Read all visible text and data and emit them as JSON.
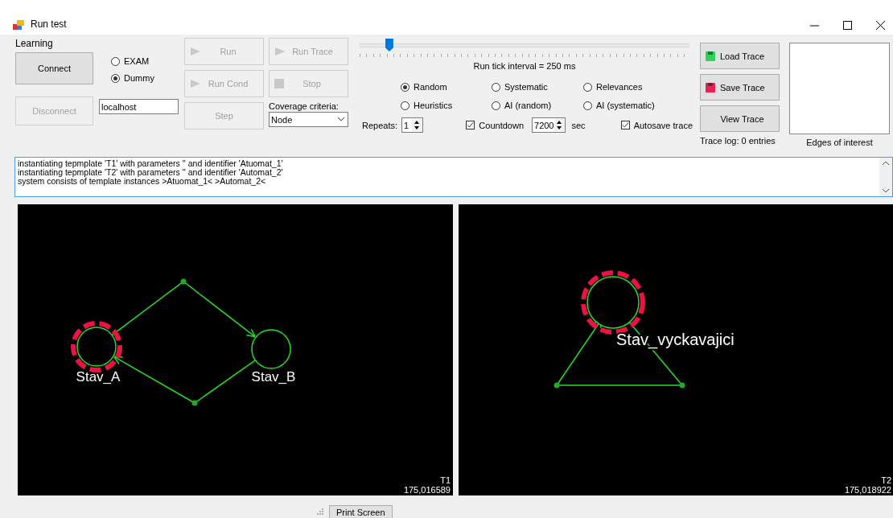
{
  "window": {
    "title": "Run test"
  },
  "learning": {
    "label": "Learning",
    "connect": {
      "label": "Connect",
      "disabled": false
    },
    "disconnect": {
      "label": "Disconnect",
      "disabled": true
    },
    "modes": [
      {
        "label": "EXAM",
        "selected": false
      },
      {
        "label": "Dummy",
        "selected": true
      }
    ],
    "host": "localhost"
  },
  "run_buttons": [
    {
      "label": "Run",
      "kind": "play",
      "disabled": true
    },
    {
      "label": "Run Cond",
      "kind": "play",
      "disabled": true
    },
    {
      "label": "Step",
      "kind": "plain",
      "disabled": true
    }
  ],
  "trace_buttons": [
    {
      "label": "Run Trace",
      "kind": "play",
      "disabled": true
    },
    {
      "label": "Stop",
      "kind": "stop",
      "disabled": true
    }
  ],
  "coverage": {
    "label": "Coverage criteria:",
    "value": "Node"
  },
  "tick_slider": {
    "level": 0.09,
    "reading": "Run tick interval = 250 ms"
  },
  "strategies": [
    {
      "label": "Random",
      "selected": true
    },
    {
      "label": "Systematic",
      "selected": false
    },
    {
      "label": "Relevances",
      "selected": false
    },
    {
      "label": "Heuristics",
      "selected": false
    },
    {
      "label": "AI (random)",
      "selected": false
    },
    {
      "label": "AI (systematic)",
      "selected": false
    }
  ],
  "repeats": {
    "label": "Repeats:",
    "value": "1"
  },
  "countdown": {
    "label": "Countdown",
    "checked": true,
    "value": "7200",
    "unit": "sec"
  },
  "autosave": {
    "label": "Autosave trace",
    "checked": true
  },
  "file_buttons": [
    {
      "label": "Load Trace",
      "kind": "load"
    },
    {
      "label": "Save Trace",
      "kind": "save"
    },
    {
      "label": "View Trace",
      "kind": "plain"
    }
  ],
  "trace_log": "Trace log: 0 entries",
  "edges_label": "Edges of interest",
  "log": [
    "instantiating tepmplate 'T1' with parameters '' and identifier 'Atuomat_1'",
    "instantiating tepmplate 'T2' with parameters '' and identifier 'Automat_2'",
    "system consists of template instances >Atuomat_1< >Automat_2<"
  ],
  "panels": [
    {
      "name": "T1",
      "time": "175,016589",
      "nodes": [
        {
          "label": "Stav_A",
          "current": true
        },
        {
          "label": "Stav_B",
          "current": false
        }
      ]
    },
    {
      "name": "T2",
      "time": "175,018922",
      "nodes": [
        {
          "label": "Stav_vyckavajici",
          "current": true
        }
      ]
    }
  ],
  "status_bar": {
    "button": "Print Screen"
  }
}
